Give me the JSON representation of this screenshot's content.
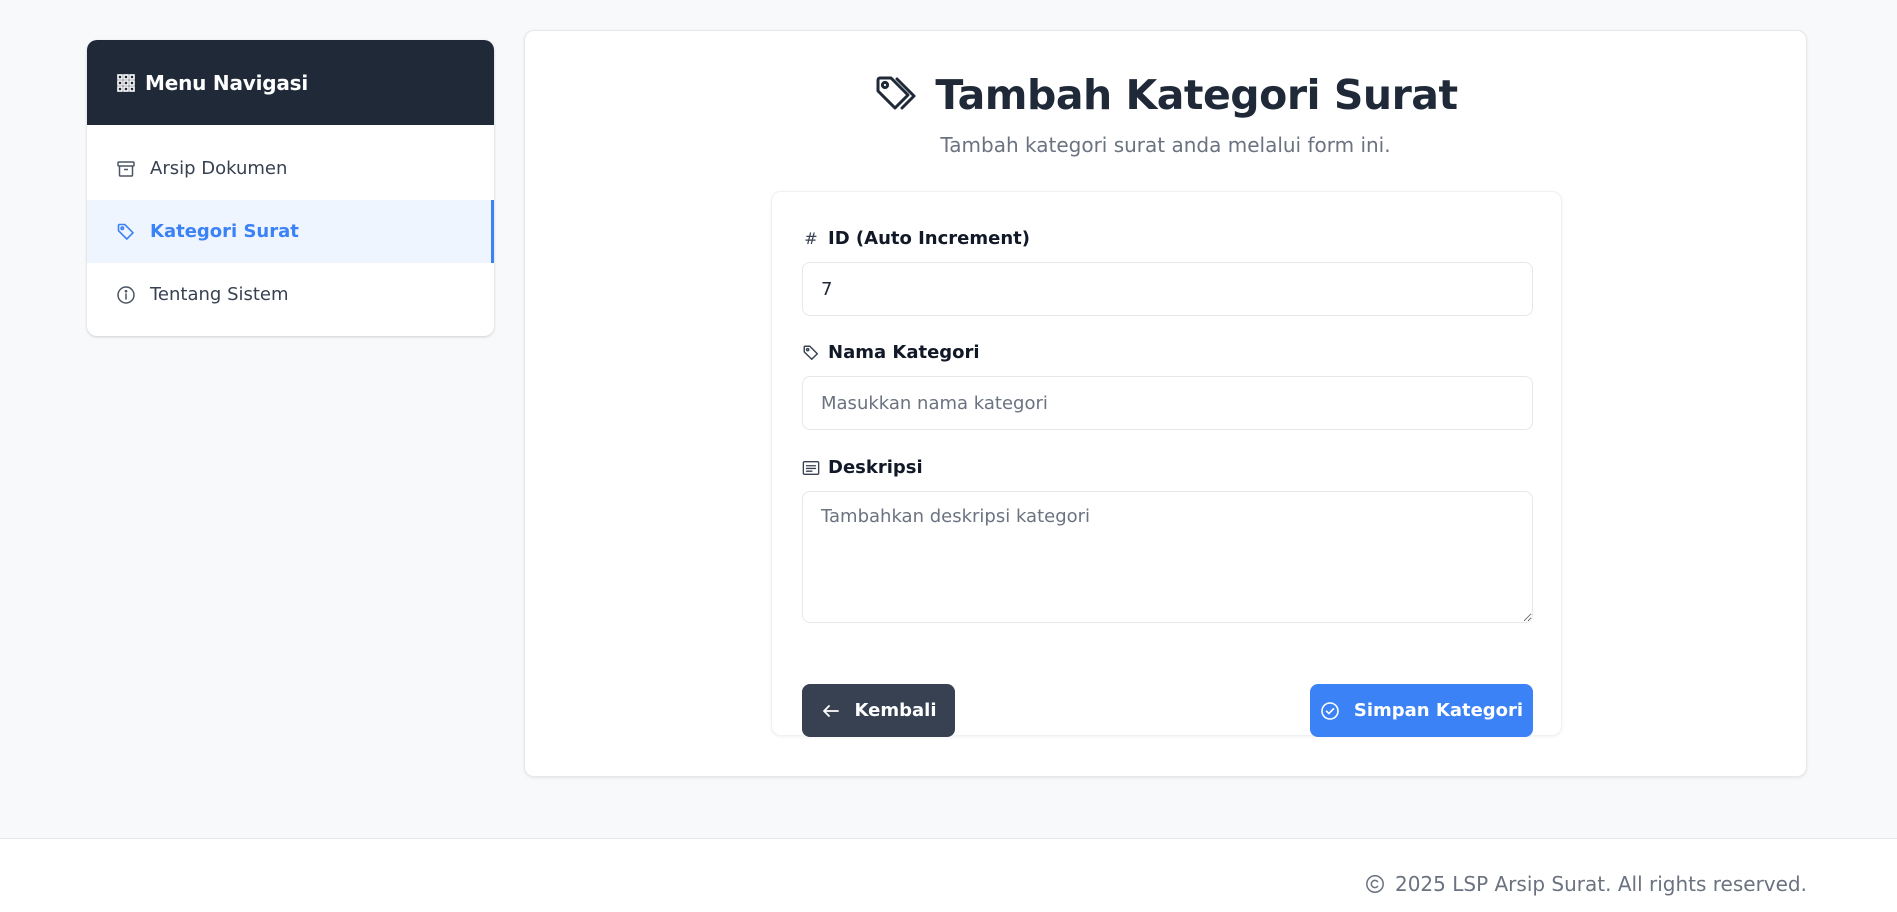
{
  "sidebar": {
    "header": {
      "icon": "grid-icon",
      "title": "Menu Navigasi"
    },
    "items": [
      {
        "icon": "archive-icon",
        "label": "Arsip Dokumen",
        "active": false
      },
      {
        "icon": "tag-icon",
        "label": "Kategori Surat",
        "active": true
      },
      {
        "icon": "info-icon",
        "label": "Tentang Sistem",
        "active": false
      }
    ]
  },
  "main": {
    "title_icon": "tags-icon",
    "title": "Tambah Kategori Surat",
    "subtitle": "Tambah kategori surat anda melalui form ini."
  },
  "form": {
    "id": {
      "icon": "hash-icon",
      "icon_glyph": "#",
      "label": "ID (Auto Increment)",
      "value": "7"
    },
    "nama": {
      "icon": "tag-icon",
      "label": "Nama Kategori",
      "value": "",
      "placeholder": "Masukkan nama kategori"
    },
    "deskripsi": {
      "icon": "document-text-icon",
      "label": "Deskripsi",
      "value": "",
      "placeholder": "Tambahkan deskripsi kategori"
    },
    "back_button": {
      "icon": "arrow-left-icon",
      "label": "Kembali"
    },
    "save_button": {
      "icon": "check-circle-icon",
      "label": "Simpan Kategori"
    }
  },
  "footer": {
    "icon": "copyright-icon",
    "text": "2025 LSP Arsip Surat. All rights reserved."
  },
  "colors": {
    "primary": "#3b82f6",
    "dark": "#1f2937",
    "button_dark": "#374151",
    "active_bg": "#eef5ff",
    "muted_text": "#6b7280"
  }
}
